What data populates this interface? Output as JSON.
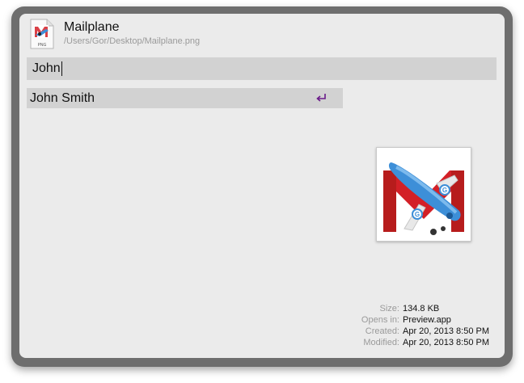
{
  "header": {
    "title": "Mailplane",
    "path": "/Users/Gor/Desktop/Mailplane.png",
    "file_type_label": "PNG"
  },
  "search": {
    "query": "John"
  },
  "results": [
    {
      "label": "John Smith",
      "action_icon": "return-key-icon"
    }
  ],
  "info": {
    "size_key": "Size:",
    "size_val": "134.8 KB",
    "opens_key": "Opens in:",
    "opens_val": "Preview.app",
    "created_key": "Created:",
    "created_val": "Apr 20, 2013 8:50 PM",
    "modified_key": "Modified:",
    "modified_val": "Apr 20, 2013 8:50 PM"
  },
  "colors": {
    "accent_return": "#6a1b8a",
    "gmail_red": "#d32027",
    "plane_blue": "#3d8fd8"
  }
}
